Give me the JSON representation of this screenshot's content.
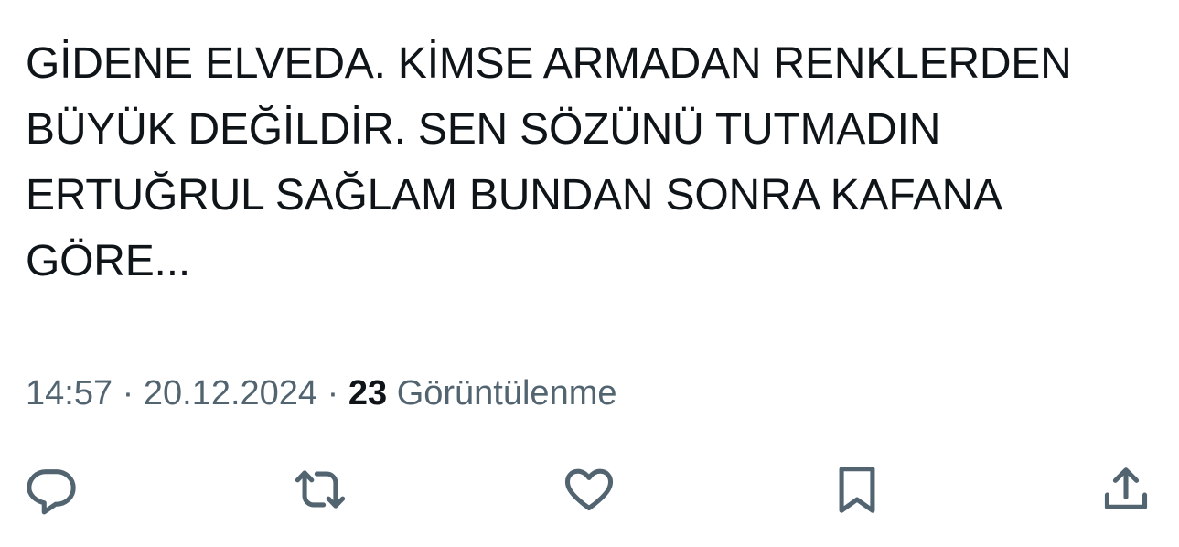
{
  "tweet": {
    "text": "GİDENE ELVEDA. KİMSE ARMADAN RENKLERDEN\nBÜYÜK DEĞİLDİR. SEN SÖZÜNÜ TUTMADIN\nERTUĞRUL SAĞLAM BUNDAN SONRA KAFANA\nGÖRE..."
  },
  "meta": {
    "time": "14:57",
    "separator": " · ",
    "date": "20.12.2024",
    "views_count": "23",
    "views_label": "Görüntülenme"
  },
  "actions": {
    "reply_icon": "reply-icon",
    "retweet_icon": "retweet-icon",
    "like_icon": "heart-icon",
    "bookmark_icon": "bookmark-icon",
    "share_icon": "share-icon",
    "icon_color": "#536471"
  },
  "colors": {
    "text_primary": "#0f1419",
    "text_secondary": "#536471",
    "background": "#ffffff"
  }
}
